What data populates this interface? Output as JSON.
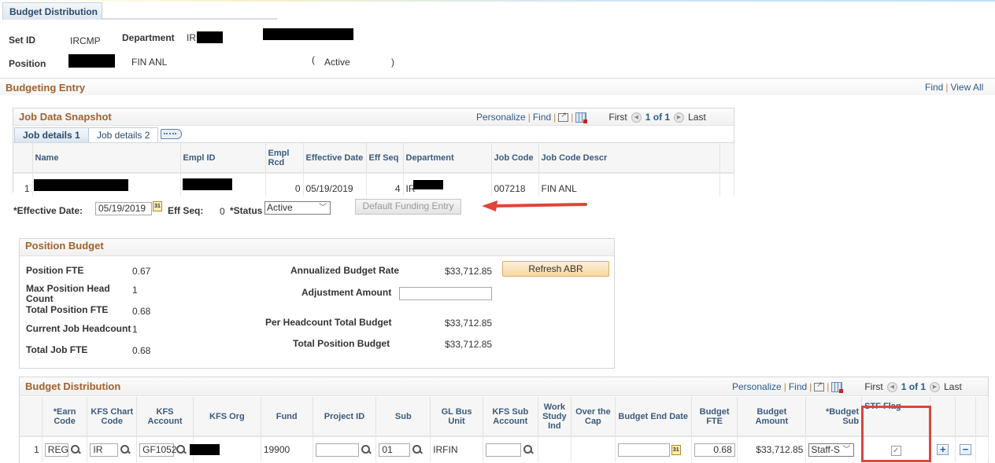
{
  "page_tab": "Budget Distribution",
  "header": {
    "setid_label": "Set ID",
    "setid_value": "IRCMP",
    "department_label": "Department",
    "department_prefix": "IR",
    "position_label": "Position",
    "position_descr": "FIN ANL",
    "status_open": "(",
    "status_value": "Active",
    "status_close": ")"
  },
  "budgeting_entry": {
    "title": "Budgeting Entry",
    "find_label": "Find",
    "viewall_label": "View All"
  },
  "job_snapshot": {
    "title": "Job Data Snapshot",
    "nav": {
      "personalize": "Personalize",
      "find": "Find",
      "first": "First",
      "count": "1 of 1",
      "last": "Last"
    },
    "tabs": [
      {
        "label": "Job details 1",
        "active": true
      },
      {
        "label": "Job details 2",
        "active": false
      }
    ],
    "columns": [
      "Name",
      "Empl ID",
      "Empl Rcd",
      "Effective Date",
      "Eff Seq",
      "Department",
      "Job Code",
      "Job Code Descr"
    ],
    "rows": [
      {
        "num": "1",
        "empl_rcd": "0",
        "effective_date": "05/19/2019",
        "eff_seq": "4",
        "dept_prefix": "IR",
        "job_code": "007218",
        "job_code_descr": "FIN ANL"
      }
    ]
  },
  "entry": {
    "effective_date_label": "*Effective Date:",
    "effective_date_value": "05/19/2019",
    "eff_seq_label": "Eff Seq:",
    "eff_seq_value": "0",
    "status_label": "*Status",
    "status_value": "Active",
    "default_funding_button": "Default Funding Entry",
    "calendar_glyph": "31"
  },
  "position_budget": {
    "title": "Position Budget",
    "position_fte_label": "Position FTE",
    "position_fte_value": "0.67",
    "max_headcount_label": "Max Position Head Count",
    "max_headcount_value": "1",
    "total_position_fte_label": "Total Position FTE",
    "total_position_fte_value": "0.68",
    "current_headcount_label": "Current Job Headcount",
    "current_headcount_value": "1",
    "total_job_fte_label": "Total Job FTE",
    "total_job_fte_value": "0.68",
    "abr_label": "Annualized Budget Rate",
    "abr_value": "$33,712.85",
    "refresh_abr_button": "Refresh ABR",
    "adjustment_label": "Adjustment Amount",
    "adjustment_value": "",
    "per_headcount_label": "Per Headcount Total Budget",
    "per_headcount_value": "$33,712.85",
    "total_position_budget_label": "Total Position Budget",
    "total_position_budget_value": "$33,712.85"
  },
  "budget_distribution": {
    "title": "Budget Distribution",
    "nav": {
      "personalize": "Personalize",
      "find": "Find",
      "first": "First",
      "count": "1 of 1",
      "last": "Last"
    },
    "columns": [
      "*Earn Code",
      "KFS Chart Code",
      "KFS Account",
      "KFS Org",
      "Fund",
      "Project ID",
      "Sub",
      "GL Bus Unit",
      "KFS Sub Account",
      "Work Study Ind",
      "Over the Cap",
      "Budget End Date",
      "Budget FTE",
      "Budget Amount",
      "*Budget Sub",
      "STF Flag"
    ],
    "rows": [
      {
        "num": "1",
        "earn_code": "REG",
        "kfs_chart_code": "IR",
        "kfs_account": "GF1052",
        "fund": "19900",
        "project_id": "",
        "sub": "01",
        "gl_bus_unit": "IRFIN",
        "kfs_sub_account": "",
        "budget_end_date": "",
        "budget_fte": "0.68",
        "budget_amount": "$33,712.85",
        "budget_sub": "Staff-S",
        "stf_flag": true
      }
    ],
    "add_row_glyph": "+",
    "delete_row_glyph": "−"
  },
  "annotation": {
    "arrow_color": "#e0443a",
    "highlight_color": "#e0443a"
  }
}
